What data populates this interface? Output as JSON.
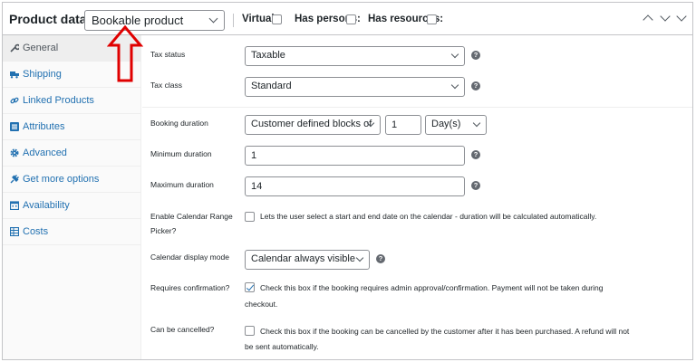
{
  "header": {
    "title": "Product data —",
    "product_type": "Bookable product",
    "virtual_label": "Virtual:",
    "has_persons_label": "Has persons:",
    "has_resources_label": "Has resources:"
  },
  "sidebar": {
    "items": [
      {
        "label": "General",
        "icon": "wrench-icon",
        "active": true
      },
      {
        "label": "Shipping",
        "icon": "truck-icon",
        "active": false
      },
      {
        "label": "Linked Products",
        "icon": "link-icon",
        "active": false
      },
      {
        "label": "Attributes",
        "icon": "list-icon",
        "active": false
      },
      {
        "label": "Advanced",
        "icon": "gear-icon",
        "active": false
      },
      {
        "label": "Get more options",
        "icon": "plugin-icon",
        "active": false
      },
      {
        "label": "Availability",
        "icon": "calendar-icon",
        "active": false
      },
      {
        "label": "Costs",
        "icon": "table-icon",
        "active": false
      }
    ]
  },
  "fields": {
    "tax_status": {
      "label": "Tax status",
      "value": "Taxable"
    },
    "tax_class": {
      "label": "Tax class",
      "value": "Standard"
    },
    "booking_duration": {
      "label": "Booking duration",
      "type": "Customer defined blocks of",
      "amount": "1",
      "unit": "Day(s)"
    },
    "minimum_duration": {
      "label": "Minimum duration",
      "value": "1"
    },
    "maximum_duration": {
      "label": "Maximum duration",
      "value": "14"
    },
    "range_picker": {
      "label_line1": "Enable Calendar Range",
      "label_line2": "Picker?",
      "description": "Lets the user select a start and end date on the calendar - duration will be calculated automatically."
    },
    "calendar_display_mode": {
      "label": "Calendar display mode",
      "value": "Calendar always visible"
    },
    "requires_confirmation": {
      "label": "Requires confirmation?",
      "description_line1": "Check this box if the booking requires admin approval/confirmation. Payment will not be taken during",
      "description_line2": "checkout.",
      "checked": true
    },
    "can_be_cancelled": {
      "label": "Can be cancelled?",
      "description_line1": "Check this box if the booking can be cancelled by the customer after it has been purchased. A refund will not",
      "description_line2": "be sent automatically.",
      "checked": false
    }
  },
  "colors": {
    "accent": "#2271b1",
    "annotation_arrow": "#e00000"
  }
}
